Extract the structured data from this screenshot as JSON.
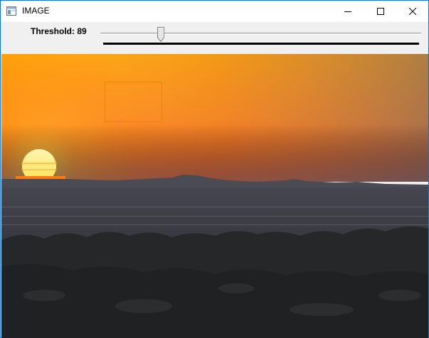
{
  "window": {
    "title": "IMAGE",
    "border_color": "#1a73c7"
  },
  "titlebar_buttons": {
    "minimize_icon": "minimize-icon",
    "maximize_icon": "maximize-icon",
    "close_icon": "close-icon"
  },
  "trackbar": {
    "label": "Threshold: 89",
    "value": 89,
    "fraction": 0.188
  },
  "image": {
    "scene": "desert-sunset",
    "roi_box_color": "#66cc00"
  }
}
